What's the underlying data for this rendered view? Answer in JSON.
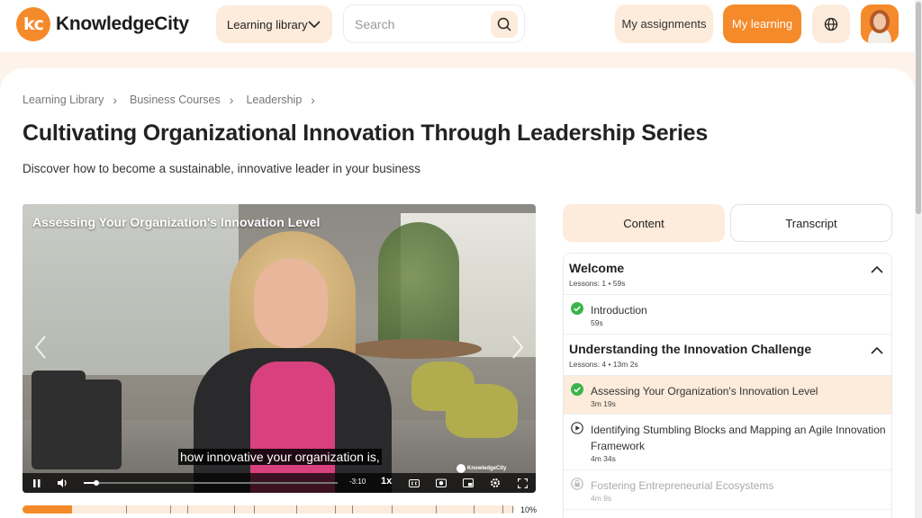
{
  "header": {
    "logo_badge": "kc",
    "logo_text": "KnowledgeCity",
    "library_button": "Learning library",
    "search_placeholder": "Search",
    "assignments_button": "My assignments",
    "learning_button": "My learning"
  },
  "breadcrumb": [
    "Learning Library",
    "Business Courses",
    "Leadership"
  ],
  "course": {
    "title": "Cultivating Organizational Innovation Through Leadership Series",
    "subtitle": "Discover how to become a sustainable, innovative leader in your business"
  },
  "video": {
    "title": "Assessing Your Organization's Innovation Level",
    "caption": "how innovative your organization is,",
    "watermark": "KnowledgeCity",
    "time_remaining": "-3:10",
    "speed": "1x",
    "progress_fraction": 0.05
  },
  "course_progress": {
    "percent_label": "10%",
    "fraction": 0.1
  },
  "tabs": {
    "content": "Content",
    "transcript": "Transcript"
  },
  "sections": [
    {
      "title": "Welcome",
      "meta": "Lessons: 1 • 59s",
      "lessons": [
        {
          "title": "Introduction",
          "duration": "59s",
          "status": "complete"
        }
      ]
    },
    {
      "title": "Understanding the Innovation Challenge",
      "meta": "Lessons: 4 • 13m 2s",
      "lessons": [
        {
          "title": "Assessing Your Organization's Innovation Level",
          "duration": "3m 19s",
          "status": "complete-active"
        },
        {
          "title": "Identifying Stumbling Blocks and Mapping an Agile Innovation Framework",
          "duration": "4m 34s",
          "status": "play"
        },
        {
          "title": "Fostering Entrepreneurial Ecosystems",
          "duration": "4m 9s",
          "status": "locked"
        }
      ]
    }
  ],
  "colors": {
    "accent": "#f58a2b",
    "accent_light": "#fdebdb",
    "complete": "#3bb54a"
  },
  "icons": [
    "chevron-down-icon",
    "search-icon",
    "globe-icon",
    "chevron-right-icon",
    "chevron-up-icon",
    "check-circle-icon",
    "play-circle-icon",
    "lock-icon"
  ]
}
